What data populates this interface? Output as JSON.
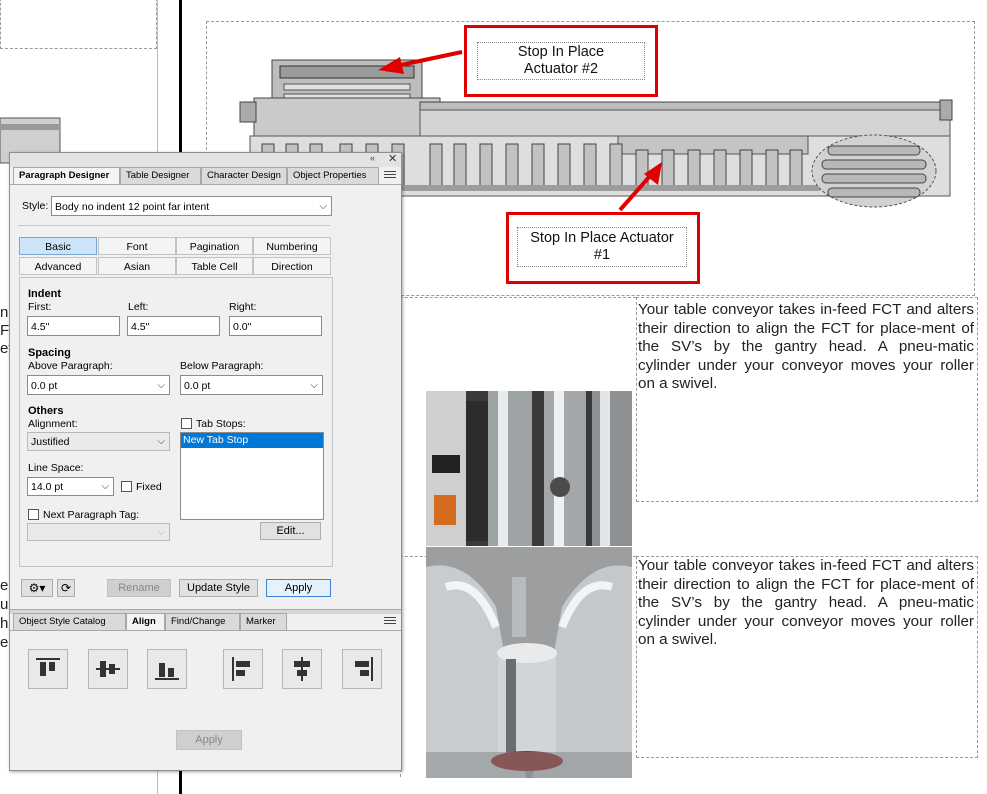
{
  "callouts": {
    "actuator2": "Stop In Place\nActuator #2",
    "actuator1": "Stop In Place Actuator\n#1"
  },
  "body_text": {
    "para1": "Your table conveyor takes in-feed FCT and alters their direction to align the FCT for place-ment of the SV’s by the gantry head. A pneu-matic cylinder under your conveyor moves your roller on a swivel.",
    "para2": "Your table conveyor takes in-feed FCT and alters their direction to align the FCT for place-ment of the SV’s by the gantry head. A pneu-matic cylinder under your conveyor moves your roller on a swivel."
  },
  "left_fragments": [
    "n",
    "F",
    "ey",
    "e",
    "ur",
    "h",
    "e"
  ],
  "panel": {
    "tabs": [
      "Paragraph Designer",
      "Table Designer",
      "Character Design",
      "Object Properties"
    ],
    "style_label": "Style:",
    "style_value": "Body no indent 12 point far intent",
    "grid_row1": [
      "Basic",
      "Font",
      "Pagination",
      "Numbering"
    ],
    "grid_row2": [
      "Advanced",
      "Asian",
      "Table Cell",
      "Direction"
    ],
    "indent": {
      "header": "Indent",
      "first_label": "First:",
      "first_value": "4.5\"",
      "left_label": "Left:",
      "left_value": "4.5\"",
      "right_label": "Right:",
      "right_value": "0.0\""
    },
    "spacing": {
      "header": "Spacing",
      "above_label": "Above Paragraph:",
      "above_value": "0.0 pt",
      "below_label": "Below Paragraph:",
      "below_value": "0.0 pt"
    },
    "others": {
      "header": "Others",
      "alignment_label": "Alignment:",
      "alignment_value": "Justified",
      "tabstops_label": "Tab Stops:",
      "tabstop_item": "New Tab Stop",
      "linespace_label": "Line Space:",
      "linespace_value": "14.0 pt",
      "fixed_label": "Fixed",
      "nextpara_label": "Next Paragraph Tag:",
      "edit_button": "Edit..."
    },
    "buttons": {
      "rename": "Rename",
      "update_style": "Update Style",
      "apply": "Apply"
    },
    "bottom_tabs": [
      "Object Style Catalog",
      "Align",
      "Find/Change",
      "Marker"
    ],
    "align_apply": "Apply"
  },
  "colors": {
    "callout_border": "#e00000",
    "selection": "#0078d7",
    "selected_tab": "#cce4f7"
  }
}
